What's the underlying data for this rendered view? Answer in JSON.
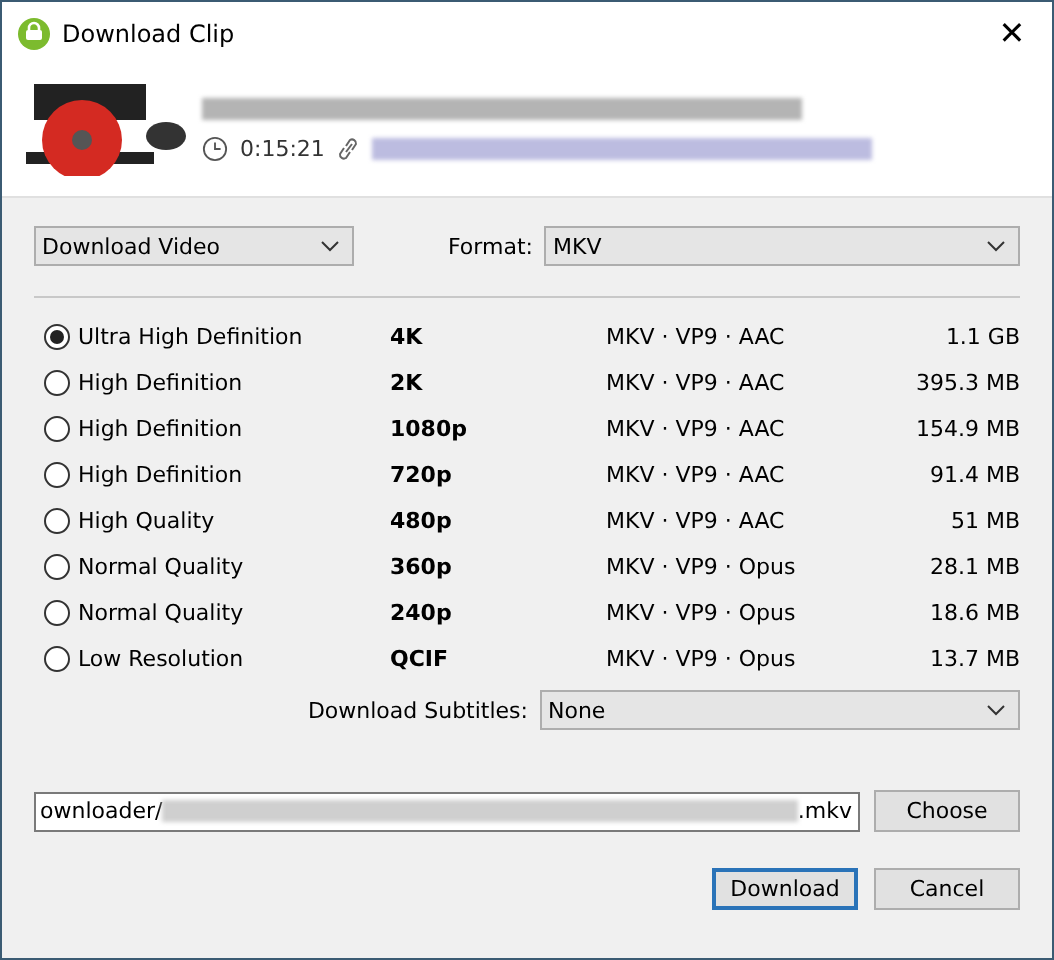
{
  "window": {
    "title": "Download Clip",
    "close": "✕"
  },
  "clip": {
    "duration": "0:15:21"
  },
  "mode_select": {
    "value": "Download Video"
  },
  "format": {
    "label": "Format:",
    "value": "MKV"
  },
  "qualities": [
    {
      "name": "Ultra High Definition",
      "resolution": "4K",
      "codecs": "MKV · VP9 · AAC",
      "size": "1.1 GB",
      "selected": true
    },
    {
      "name": "High Definition",
      "resolution": "2K",
      "codecs": "MKV · VP9 · AAC",
      "size": "395.3 MB",
      "selected": false
    },
    {
      "name": "High Definition",
      "resolution": "1080p",
      "codecs": "MKV · VP9 · AAC",
      "size": "154.9 MB",
      "selected": false
    },
    {
      "name": "High Definition",
      "resolution": "720p",
      "codecs": "MKV · VP9 · AAC",
      "size": "91.4 MB",
      "selected": false
    },
    {
      "name": "High Quality",
      "resolution": "480p",
      "codecs": "MKV · VP9 · AAC",
      "size": "51 MB",
      "selected": false
    },
    {
      "name": "Normal Quality",
      "resolution": "360p",
      "codecs": "MKV · VP9 · Opus",
      "size": "28.1 MB",
      "selected": false
    },
    {
      "name": "Normal Quality",
      "resolution": "240p",
      "codecs": "MKV · VP9 · Opus",
      "size": "18.6 MB",
      "selected": false
    },
    {
      "name": "Low Resolution",
      "resolution": "QCIF",
      "codecs": "MKV · VP9 · Opus",
      "size": "13.7 MB",
      "selected": false
    }
  ],
  "subtitles": {
    "label": "Download Subtitles:",
    "value": "None"
  },
  "path": {
    "start": "ownloader/",
    "end": ".mkv",
    "button": "Choose"
  },
  "buttons": [
    {
      "label": "Download",
      "default": true
    },
    {
      "label": "Cancel",
      "default": false
    }
  ]
}
